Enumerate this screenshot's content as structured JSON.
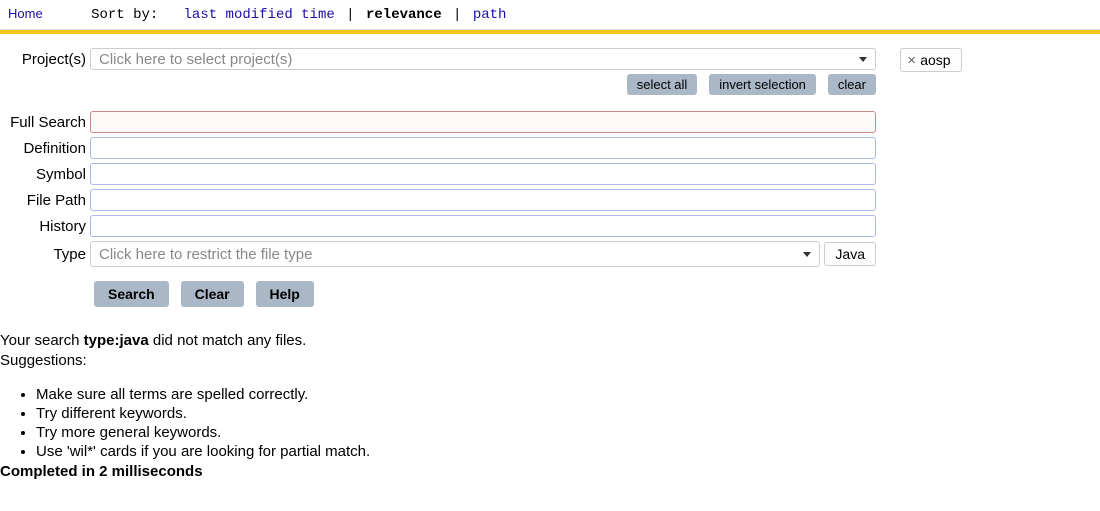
{
  "topbar": {
    "home": "Home",
    "sort_label": "Sort by:",
    "sort_options": {
      "lmt": "last modified time",
      "relevance": "relevance",
      "path": "path"
    }
  },
  "projects": {
    "label": "Project(s)",
    "placeholder": "Click here to select project(s)",
    "select_all": "select all",
    "invert": "invert selection",
    "clear": "clear",
    "tag": "aosp"
  },
  "fields": {
    "full_search": "Full Search",
    "definition": "Definition",
    "symbol": "Symbol",
    "file_path": "File Path",
    "history": "History",
    "type": "Type",
    "type_placeholder": "Click here to restrict the file type",
    "type_button": "Java"
  },
  "actions": {
    "search": "Search",
    "clear": "Clear",
    "help": "Help"
  },
  "results": {
    "prefix": "Your search ",
    "query": "type:java",
    "suffix": " did not match any files.",
    "suggestions_label": "Suggestions:",
    "suggestions": [
      "Make sure all terms are spelled correctly.",
      "Try different keywords.",
      "Try more general keywords.",
      "Use 'wil*' cards if you are looking for partial match."
    ],
    "completed": "Completed in 2 milliseconds"
  }
}
